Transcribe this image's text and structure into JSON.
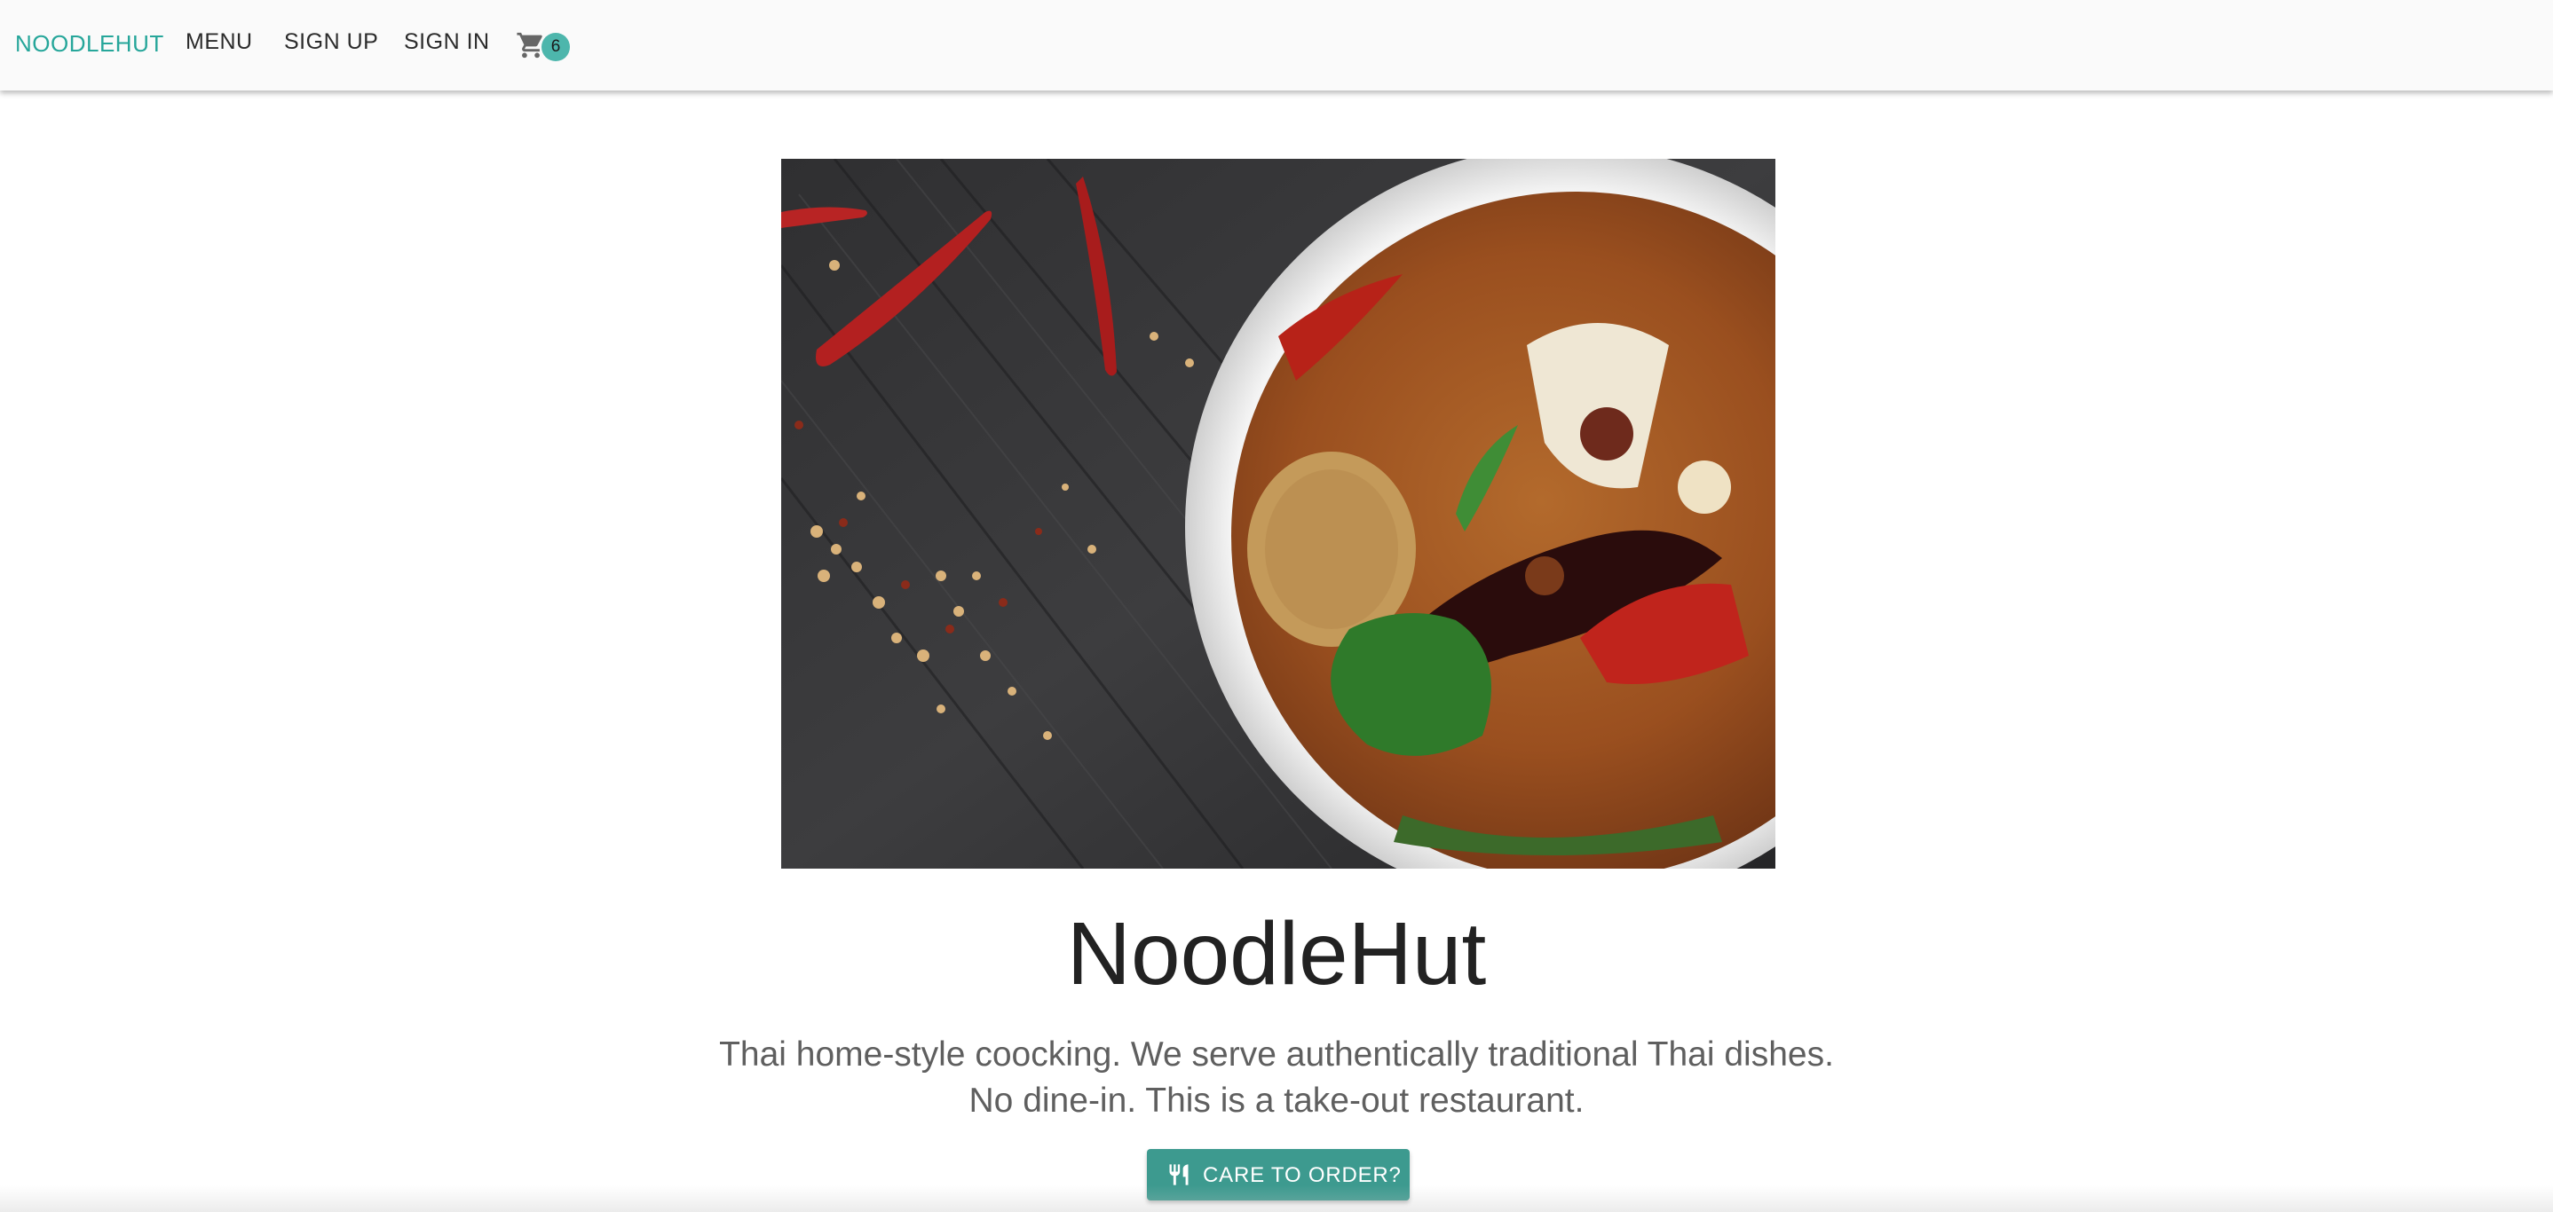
{
  "nav": {
    "brand": "NOODLEHUT",
    "links": {
      "menu": "MENU",
      "signup": "SIGN UP",
      "signin": "SIGN IN"
    },
    "cart": {
      "icon": "shopping-cart-icon",
      "count": "6"
    }
  },
  "hero": {
    "image": "thai-curry-bowl-photo"
  },
  "main": {
    "title": "NoodleHut",
    "tagline_line1": "Thai home-style coocking. We serve authentically traditional Thai dishes.",
    "tagline_line2": "No dine-in. This is a take-out restaurant.",
    "cta": {
      "icon": "fork-knife-icon",
      "label": "CARE TO ORDER?"
    }
  },
  "colors": {
    "brand": "#26a69a",
    "badge": "#4db6ac",
    "button": "#3d9a8f",
    "navbar_bg": "#fafafa"
  }
}
